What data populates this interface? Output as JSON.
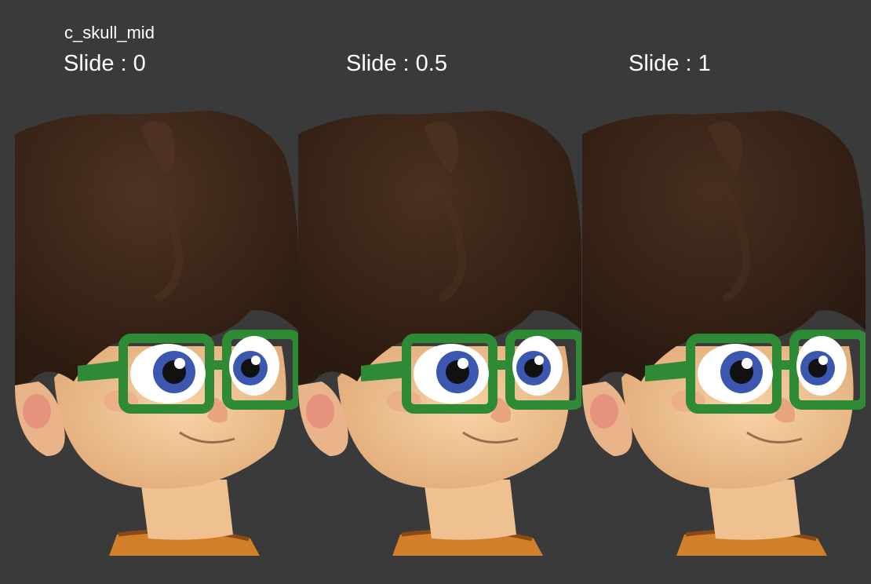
{
  "control_name": "c_skull_mid",
  "panels": [
    {
      "label": "Slide : 0",
      "slide_value": 0
    },
    {
      "label": "Slide : 0.5",
      "slide_value": 0.5
    },
    {
      "label": "Slide : 1",
      "slide_value": 1
    }
  ],
  "colors": {
    "background": "#3a3a3a",
    "hair": "#3b2518",
    "skin": "#f2c796",
    "glasses": "#2e8a35",
    "iris": "#3b57b0",
    "shirt": "#d27f2a"
  }
}
